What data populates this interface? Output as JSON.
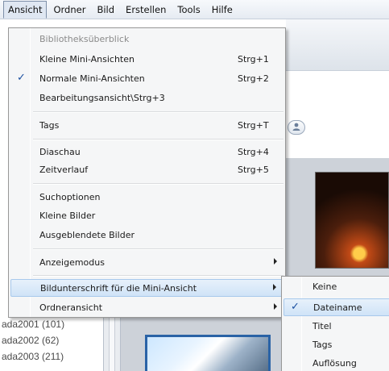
{
  "menubar": {
    "items": [
      "Ansicht",
      "Ordner",
      "Bild",
      "Erstellen",
      "Tools",
      "Hilfe"
    ],
    "active": "Ansicht"
  },
  "menu": {
    "items": [
      {
        "label": "Bibliotheksüberblick",
        "shortcut": "",
        "disabled": true
      },
      {
        "label": "Kleine Mini-Ansichten",
        "shortcut": "Strg+1"
      },
      {
        "label": "Normale Mini-Ansichten",
        "shortcut": "Strg+2",
        "checked": true
      },
      {
        "label": "Bearbeitungsansicht\\Strg+3",
        "shortcut": ""
      },
      {
        "label": "Tags",
        "shortcut": "Strg+T"
      },
      {
        "label": "Diaschau",
        "shortcut": "Strg+4"
      },
      {
        "label": "Zeitverlauf",
        "shortcut": "Strg+5"
      },
      {
        "label": "Suchoptionen",
        "shortcut": ""
      },
      {
        "label": "Kleine Bilder",
        "shortcut": ""
      },
      {
        "label": "Ausgeblendete Bilder",
        "shortcut": ""
      },
      {
        "label": "Anzeigemodus",
        "shortcut": "",
        "submenu": true
      },
      {
        "label": "Bildunterschrift für die Mini-Ansicht",
        "shortcut": "",
        "submenu": true,
        "highlighted": true
      },
      {
        "label": "Ordneransicht",
        "shortcut": "",
        "submenu": true
      }
    ],
    "check_glyph": "✓"
  },
  "submenu": {
    "items": [
      {
        "label": "Keine"
      },
      {
        "label": "Dateiname",
        "checked": true,
        "highlighted": true
      },
      {
        "label": "Titel"
      },
      {
        "label": "Tags"
      },
      {
        "label": "Auflösung"
      }
    ]
  },
  "folders": [
    "ada2001 (101)",
    "ada2002 (62)",
    "ada2003 (211)"
  ],
  "colors": {
    "accent": "#2a63a6",
    "highlight": "#cfe3f7",
    "menu_bg": "#f5f6f7"
  }
}
